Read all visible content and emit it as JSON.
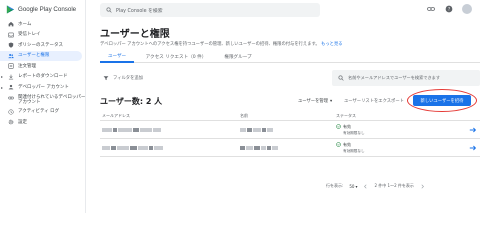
{
  "brand": {
    "name": "Google Play Console"
  },
  "sidebar": {
    "items": [
      {
        "label": "ホーム",
        "icon": "home-icon"
      },
      {
        "label": "受信トレイ",
        "icon": "inbox-icon",
        "badge": "0"
      },
      {
        "label": "ポリシーのステータス",
        "icon": "shield-icon"
      },
      {
        "label": "ユーザーと権限",
        "icon": "users-icon",
        "active": true
      },
      {
        "label": "注文管理",
        "icon": "orders-icon"
      },
      {
        "label": "レポートのダウンロード",
        "icon": "download-icon",
        "expandable": true
      },
      {
        "label": "デベロッパー アカウント",
        "icon": "account-icon",
        "expandable": true
      },
      {
        "label": "関連付けられているデベロッパー アカウント",
        "icon": "link-icon"
      },
      {
        "label": "アクティビティ ログ",
        "icon": "history-icon"
      },
      {
        "label": "設定",
        "icon": "gear-icon"
      }
    ]
  },
  "topbar": {
    "search_placeholder": "Play Console を検索"
  },
  "main": {
    "title": "ユーザーと権限",
    "description": "デベロッパー アカウントへのアクセス権を持つユーザーの管理、新しいユーザーの招待、権限の付与を行えます。",
    "learn_more": "もっと見る",
    "tabs": [
      {
        "label": "ユーザー",
        "active": true
      },
      {
        "label": "アクセス リクエスト（0 件）"
      },
      {
        "label": "権限グループ"
      }
    ],
    "filter_label": "フィルタを追加",
    "search_placeholder": "名前やメールアドレスでユーザーを検索できます",
    "count_label": "ユーザー数: 2 人",
    "manage_label": "ユーザーを管理",
    "export_label": "ユーザーリストをエクスポート",
    "invite_label": "新しいユーザーを招待"
  },
  "table": {
    "headers": [
      "メールアドレス",
      "名前",
      "ステータス"
    ],
    "rows": [
      {
        "status": "有効",
        "status_sub": "有効期限なし"
      },
      {
        "status": "有効",
        "status_sub": "有効期限なし"
      }
    ]
  },
  "pager": {
    "rows_label": "行を表示:",
    "rows_value": "50",
    "range_label": "2 件中 1～2 件を表示"
  }
}
